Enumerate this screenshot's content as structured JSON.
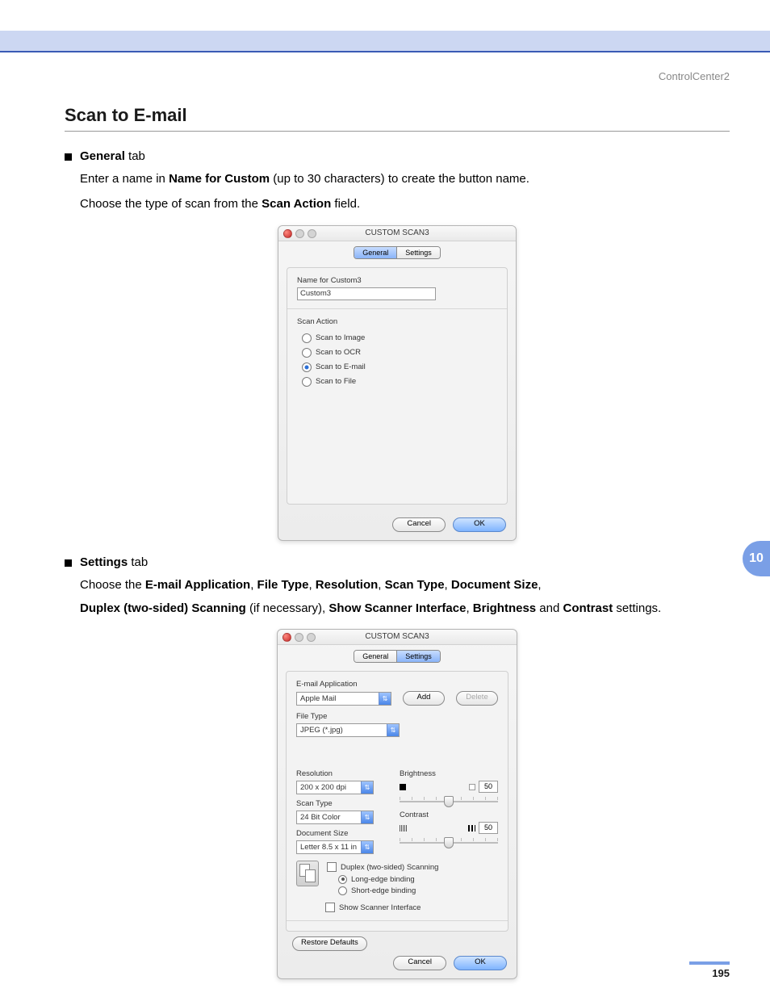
{
  "header": {
    "brand": "ControlCenter2"
  },
  "title": "Scan to E-mail",
  "section_general": {
    "bullet_label_strong": "General",
    "bullet_label_rest": " tab",
    "p1_pre": "Enter a name in ",
    "p1_b": "Name for Custom",
    "p1_post": " (up to 30 characters) to create the button name.",
    "p2_pre": "Choose the type of scan from the ",
    "p2_b": "Scan Action",
    "p2_post": " field."
  },
  "win1": {
    "title": "CUSTOM SCAN3",
    "tab_general": "General",
    "tab_settings": "Settings",
    "name_label": "Name for Custom3",
    "name_value": "Custom3",
    "scan_action_label": "Scan Action",
    "options": {
      "image": "Scan to Image",
      "ocr": "Scan to OCR",
      "email": "Scan to E-mail",
      "file": "Scan to File"
    },
    "cancel": "Cancel",
    "ok": "OK"
  },
  "section_settings": {
    "bullet_label_strong": "Settings",
    "bullet_label_rest": " tab",
    "p1_pre": "Choose the ",
    "p1_b1": "E-mail Application",
    "p1_b2": "File Type",
    "p1_b3": "Resolution",
    "p1_b4": "Scan Type",
    "p1_b5": "Document Size",
    "p2_b1": "Duplex  (two-sided) Scanning",
    "p2_mid1": " (if necessary), ",
    "p2_b2": "Show Scanner Interface",
    "p2_b3": "Brightness",
    "p2_and": " and ",
    "p2_b4": "Contrast",
    "p2_post": " settings."
  },
  "win2": {
    "title": "CUSTOM SCAN3",
    "tab_general": "General",
    "tab_settings": "Settings",
    "email_app_label": "E-mail Application",
    "email_app_value": "Apple Mail",
    "add": "Add",
    "delete": "Delete",
    "file_type_label": "File Type",
    "file_type_value": "JPEG (*.jpg)",
    "resolution_label": "Resolution",
    "resolution_value": "200 x 200 dpi",
    "scan_type_label": "Scan Type",
    "scan_type_value": "24 Bit Color",
    "doc_size_label": "Document Size",
    "doc_size_value": "Letter  8.5 x 11 in",
    "brightness_label": "Brightness",
    "brightness_value": "50",
    "contrast_label": "Contrast",
    "contrast_value": "50",
    "duplex_label": "Duplex (two-sided) Scanning",
    "long_edge": "Long-edge binding",
    "short_edge": "Short-edge binding",
    "show_scanner": "Show Scanner Interface",
    "restore": "Restore Defaults",
    "cancel": "Cancel",
    "ok": "OK"
  },
  "side_tab": "10",
  "page_number": "195",
  "comma": ", "
}
